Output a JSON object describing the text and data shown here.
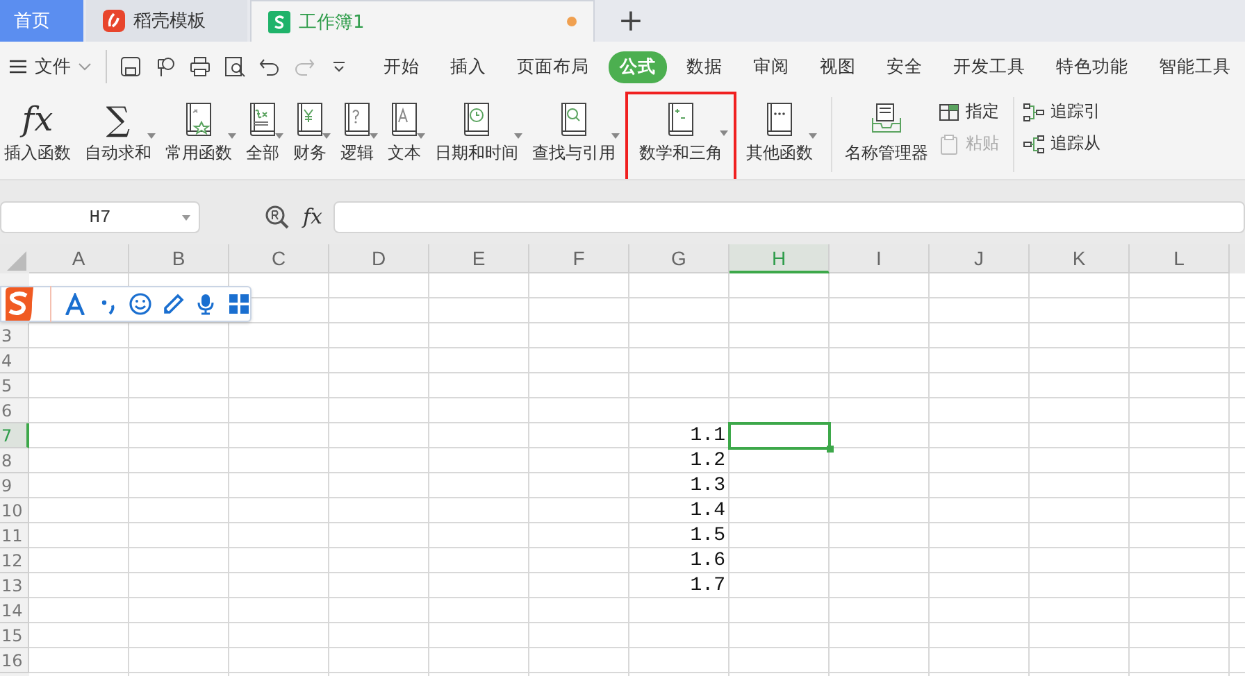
{
  "tabs": [
    {
      "label": "首页",
      "kind": "home",
      "selected": false
    },
    {
      "label": "稻壳模板",
      "kind": "docer",
      "selected": false
    },
    {
      "label": "工作簿1",
      "kind": "sheet",
      "selected": true,
      "unsaved": true
    }
  ],
  "new_tab": "+",
  "file_menu": "文件",
  "quick_access": [
    {
      "kind": "save",
      "disabled": false
    },
    {
      "kind": "format-painter",
      "disabled": false
    },
    {
      "kind": "print",
      "disabled": false
    },
    {
      "kind": "preview",
      "disabled": false
    },
    {
      "kind": "undo",
      "disabled": false
    },
    {
      "kind": "redo",
      "disabled": true
    },
    {
      "kind": "more",
      "disabled": false
    }
  ],
  "menu": [
    {
      "label": "开始",
      "selected": false
    },
    {
      "label": "插入",
      "selected": false
    },
    {
      "label": "页面布局",
      "selected": false
    },
    {
      "label": "公式",
      "selected": true
    },
    {
      "label": "数据",
      "selected": false
    },
    {
      "label": "审阅",
      "selected": false
    },
    {
      "label": "视图",
      "selected": false
    },
    {
      "label": "安全",
      "selected": false
    },
    {
      "label": "开发工具",
      "selected": false
    },
    {
      "label": "特色功能",
      "selected": false
    },
    {
      "label": "智能工具",
      "selected": false
    }
  ],
  "ribbon": [
    {
      "kind": "symbol",
      "symbol": "fx",
      "label": "插入函数",
      "dropdown": false,
      "highlighted": false
    },
    {
      "kind": "symbol",
      "symbol": "∑",
      "label": "自动求和",
      "dropdown": true,
      "highlighted": false
    },
    {
      "kind": "book",
      "label": "常用函数",
      "dropdown": true,
      "highlighted": false
    },
    {
      "kind": "book",
      "label": "全部",
      "dropdown": true,
      "highlighted": false
    },
    {
      "kind": "book",
      "label": "财务",
      "dropdown": true,
      "highlighted": false
    },
    {
      "kind": "book",
      "label": "逻辑",
      "dropdown": true,
      "highlighted": false
    },
    {
      "kind": "book",
      "label": "文本",
      "dropdown": true,
      "highlighted": false
    },
    {
      "kind": "book",
      "label": "日期和时间",
      "dropdown": true,
      "highlighted": false
    },
    {
      "kind": "book",
      "label": "查找与引用",
      "dropdown": true,
      "highlighted": false
    },
    {
      "kind": "book",
      "label": "数学和三角",
      "dropdown": true,
      "highlighted": true
    },
    {
      "kind": "book",
      "label": "其他函数",
      "dropdown": true,
      "highlighted": false
    },
    {
      "kind": "separator"
    },
    {
      "kind": "tray",
      "label": "名称管理器",
      "dropdown": false,
      "highlighted": false
    },
    {
      "kind": "stack",
      "items": [
        {
          "label": "指定",
          "disabled": false
        },
        {
          "label": "粘贴",
          "disabled": true
        }
      ]
    },
    {
      "kind": "separator"
    },
    {
      "kind": "stack",
      "items": [
        {
          "label": "追踪引",
          "disabled": false
        },
        {
          "label": "追踪从",
          "disabled": false
        }
      ]
    }
  ],
  "name_box": "H7",
  "formula_symbol": "fx",
  "columns": [
    {
      "label": "A",
      "selected": false
    },
    {
      "label": "B",
      "selected": false
    },
    {
      "label": "C",
      "selected": false
    },
    {
      "label": "D",
      "selected": false
    },
    {
      "label": "E",
      "selected": false
    },
    {
      "label": "F",
      "selected": false
    },
    {
      "label": "G",
      "selected": false
    },
    {
      "label": "H",
      "selected": true
    },
    {
      "label": "I",
      "selected": false
    },
    {
      "label": "J",
      "selected": false
    },
    {
      "label": "K",
      "selected": false
    },
    {
      "label": "L",
      "selected": false
    }
  ],
  "rows": [
    {},
    {},
    {
      "label": "3",
      "selected": false
    },
    {
      "label": "4",
      "selected": false
    },
    {
      "label": "5",
      "selected": false
    },
    {
      "label": "6",
      "selected": false
    },
    {
      "label": "7",
      "selected": true,
      "cells": [
        {},
        {},
        {},
        {},
        {},
        {},
        {
          "value": "1.1"
        },
        {
          "selected": true
        }
      ]
    },
    {
      "label": "8",
      "selected": false,
      "cells": [
        {},
        {},
        {},
        {},
        {},
        {},
        {
          "value": "1.2"
        }
      ]
    },
    {
      "label": "9",
      "selected": false,
      "cells": [
        {},
        {},
        {},
        {},
        {},
        {},
        {
          "value": "1.3"
        }
      ]
    },
    {
      "label": "10",
      "selected": false,
      "cells": [
        {},
        {},
        {},
        {},
        {},
        {},
        {
          "value": "1.4"
        }
      ]
    },
    {
      "label": "11",
      "selected": false,
      "cells": [
        {},
        {},
        {},
        {},
        {},
        {},
        {
          "value": "1.5"
        }
      ]
    },
    {
      "label": "12",
      "selected": false,
      "cells": [
        {},
        {},
        {},
        {},
        {},
        {},
        {
          "value": "1.6"
        }
      ]
    },
    {
      "label": "13",
      "selected": false,
      "cells": [
        {},
        {},
        {},
        {},
        {},
        {},
        {
          "value": "1.7"
        }
      ]
    },
    {
      "label": "14",
      "selected": false
    },
    {
      "label": "15",
      "selected": false
    },
    {
      "label": "16",
      "selected": false
    }
  ]
}
